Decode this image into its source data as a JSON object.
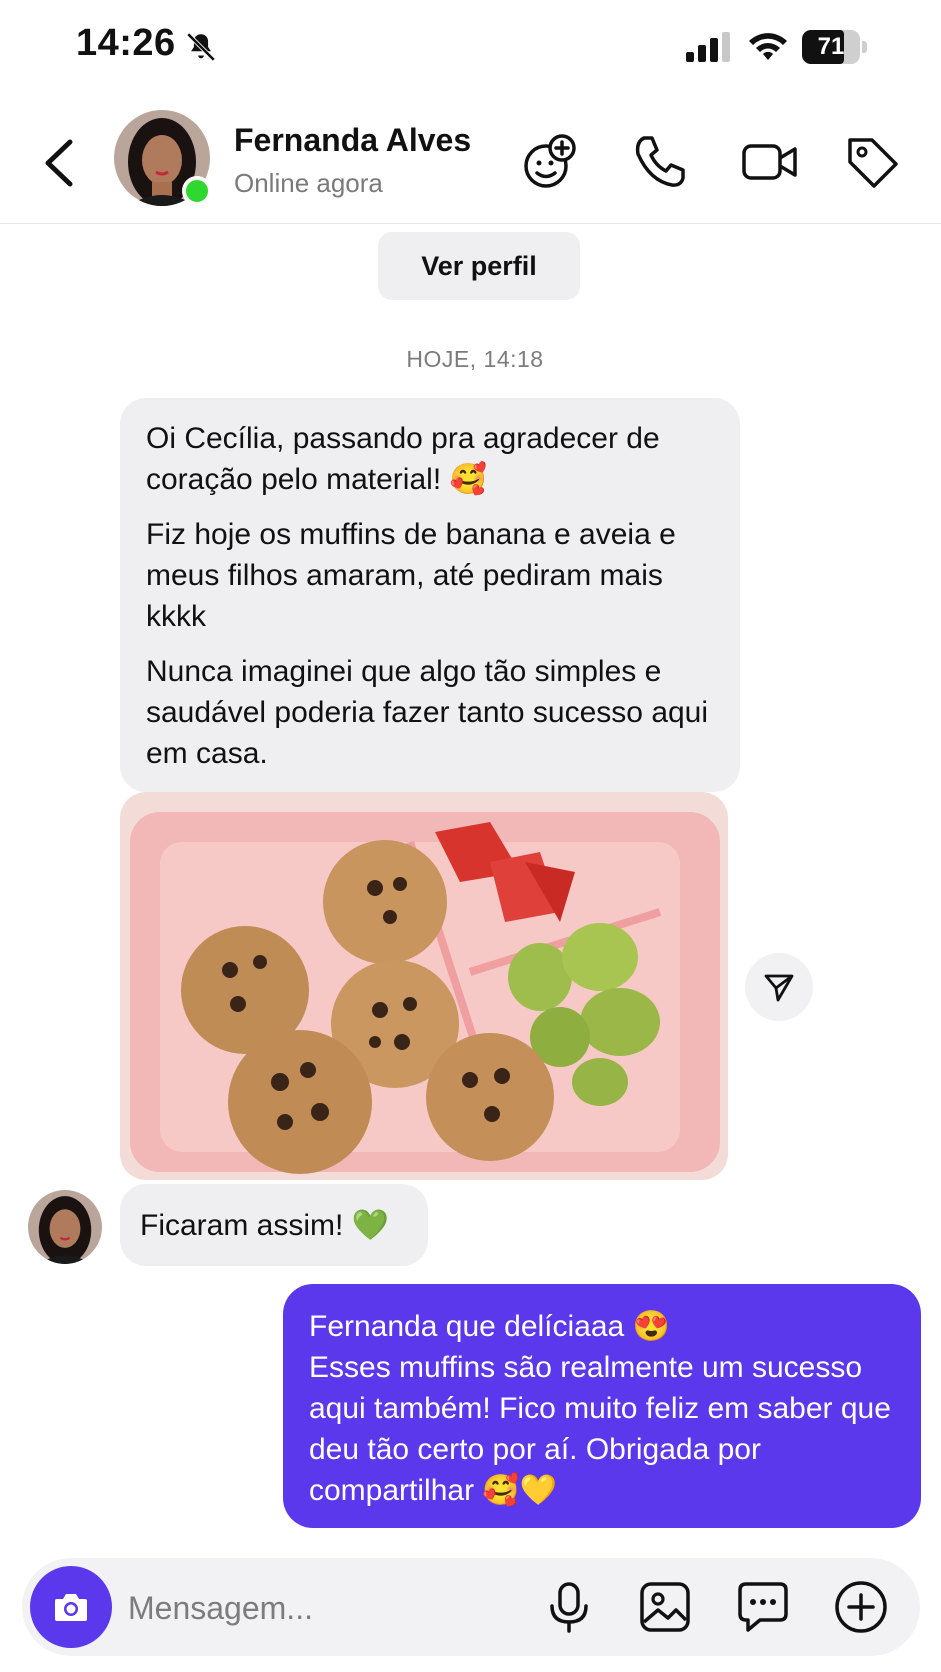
{
  "status_bar": {
    "time": "14:26",
    "battery": "71",
    "icons": [
      "bell-slash-icon",
      "signal-icon",
      "wifi-icon",
      "battery-icon"
    ]
  },
  "header": {
    "contact_name": "Fernanda Alves",
    "contact_status": "Online agora",
    "icons": [
      "back-icon",
      "add-emoji-icon",
      "phone-icon",
      "video-icon",
      "tag-icon"
    ]
  },
  "thread": {
    "view_profile_label": "Ver perfil",
    "date_separator": "HOJE, 14:18",
    "incoming_paragraphs": [
      "Oi Cecília, passando pra agradecer de coração pelo material! 🥰",
      "Fiz hoje os muffins de banana e aveia e meus filhos amaram, até pediram mais kkkk",
      "Nunca imaginei que algo tão simples e saudável poderia fazer tanto sucesso aqui em casa."
    ],
    "short_message": "Ficaram assim! 💚",
    "outgoing_message": "Fernanda que delíciaaa 😍\nEsses muffins são realmente um sucesso aqui também! Fico muito feliz em saber que deu tão certo por aí. Obrigada por compartilhar 🥰💛"
  },
  "composer": {
    "placeholder": "Mensagem...",
    "icons": [
      "camera-icon",
      "microphone-icon",
      "image-icon",
      "chat-bubble-icon",
      "plus-circle-icon"
    ]
  },
  "colors": {
    "accent": "#5b38ec",
    "bubble_in": "#efeff1",
    "online": "#2ed82e"
  }
}
